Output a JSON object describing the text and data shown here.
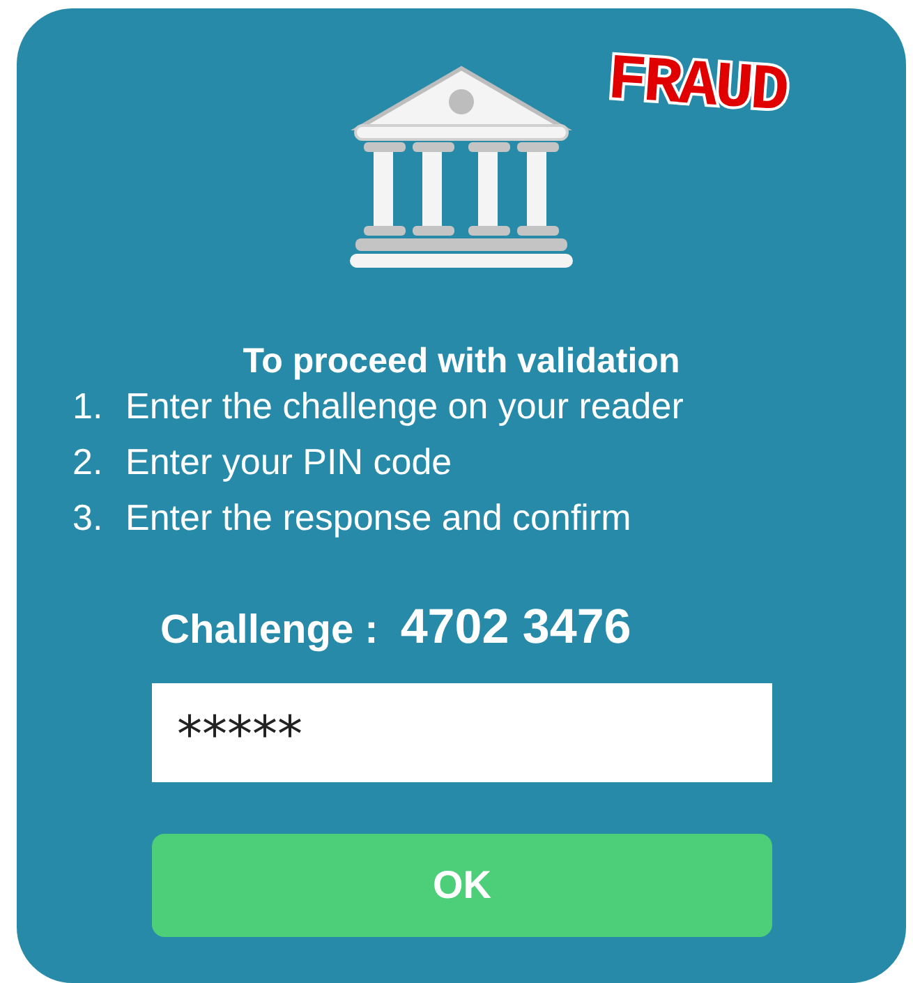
{
  "stamp": {
    "label": "FRAUD"
  },
  "heading": "To proceed with validation",
  "steps": [
    {
      "number": "1.",
      "text": "Enter the challenge on your reader"
    },
    {
      "number": "2.",
      "text": "Enter your PIN code"
    },
    {
      "number": "3.",
      "text": "Enter the response and confirm"
    }
  ],
  "challenge": {
    "label": "Challenge :",
    "value": "4702 3476"
  },
  "response_field": {
    "value": "*****"
  },
  "buttons": [
    {
      "label": "OK"
    }
  ]
}
